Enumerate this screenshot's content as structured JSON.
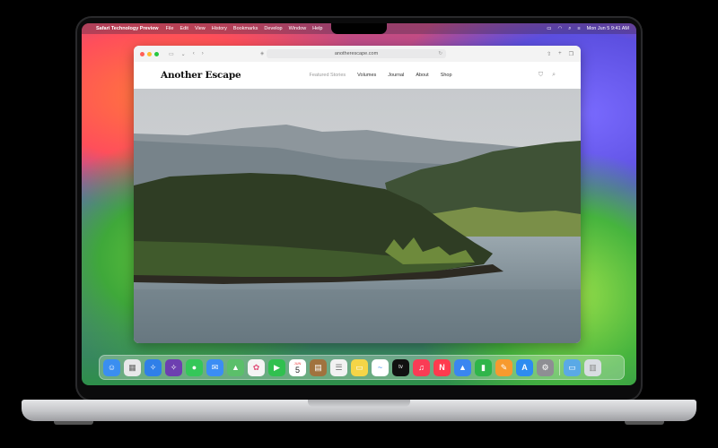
{
  "menubar": {
    "app_name": "Safari Technology Preview",
    "items": [
      "File",
      "Edit",
      "View",
      "History",
      "Bookmarks",
      "Develop",
      "Window",
      "Help"
    ],
    "datetime": "Mon Jun 5  9:41 AM"
  },
  "browser": {
    "url": "anotherescape.com"
  },
  "site": {
    "logo": "Another Escape",
    "nav": [
      "Featured Stories",
      "Volumes",
      "Journal",
      "About",
      "Shop"
    ]
  },
  "dock": {
    "calendar_day": "5",
    "calendar_month": "JUN",
    "apps": [
      {
        "name": "finder",
        "color": "#3a8ef0",
        "glyph": "☺"
      },
      {
        "name": "launchpad",
        "color": "#e8e8ea",
        "glyph": "▦"
      },
      {
        "name": "safari",
        "color": "#2f7fe8",
        "glyph": "✧"
      },
      {
        "name": "safari-preview",
        "color": "#6d3fb0",
        "glyph": "✧"
      },
      {
        "name": "messages",
        "color": "#34c759",
        "glyph": "●"
      },
      {
        "name": "mail",
        "color": "#3b8df4",
        "glyph": "✉"
      },
      {
        "name": "maps",
        "color": "#5bbf6a",
        "glyph": "▲"
      },
      {
        "name": "photos",
        "color": "#f4f4f4",
        "glyph": "✿"
      },
      {
        "name": "facetime",
        "color": "#30c04f",
        "glyph": "▶"
      },
      {
        "name": "calendar",
        "color": "#ffffff",
        "glyph": ""
      },
      {
        "name": "notes-brown",
        "color": "#a0733e",
        "glyph": "▤"
      },
      {
        "name": "reminders",
        "color": "#f2f2f2",
        "glyph": "☰"
      },
      {
        "name": "notes",
        "color": "#f5d547",
        "glyph": "▭"
      },
      {
        "name": "freeform",
        "color": "#ffffff",
        "glyph": "~"
      },
      {
        "name": "tv",
        "color": "#111111",
        "glyph": "tv"
      },
      {
        "name": "music",
        "color": "#fa3c55",
        "glyph": "♫"
      },
      {
        "name": "news",
        "color": "#ff3b4e",
        "glyph": "N"
      },
      {
        "name": "keynote",
        "color": "#3a86f0",
        "glyph": "▲"
      },
      {
        "name": "numbers",
        "color": "#2fb54a",
        "glyph": "▮"
      },
      {
        "name": "pages",
        "color": "#f79a2e",
        "glyph": "✎"
      },
      {
        "name": "app-store",
        "color": "#2d8cf0",
        "glyph": "A"
      },
      {
        "name": "system-settings",
        "color": "#8e8e93",
        "glyph": "⚙"
      }
    ],
    "trailing": [
      {
        "name": "downloads-folder",
        "color": "#5aa9e6",
        "glyph": "▭"
      },
      {
        "name": "trash",
        "color": "#d9dde2",
        "glyph": "🗑"
      }
    ]
  }
}
